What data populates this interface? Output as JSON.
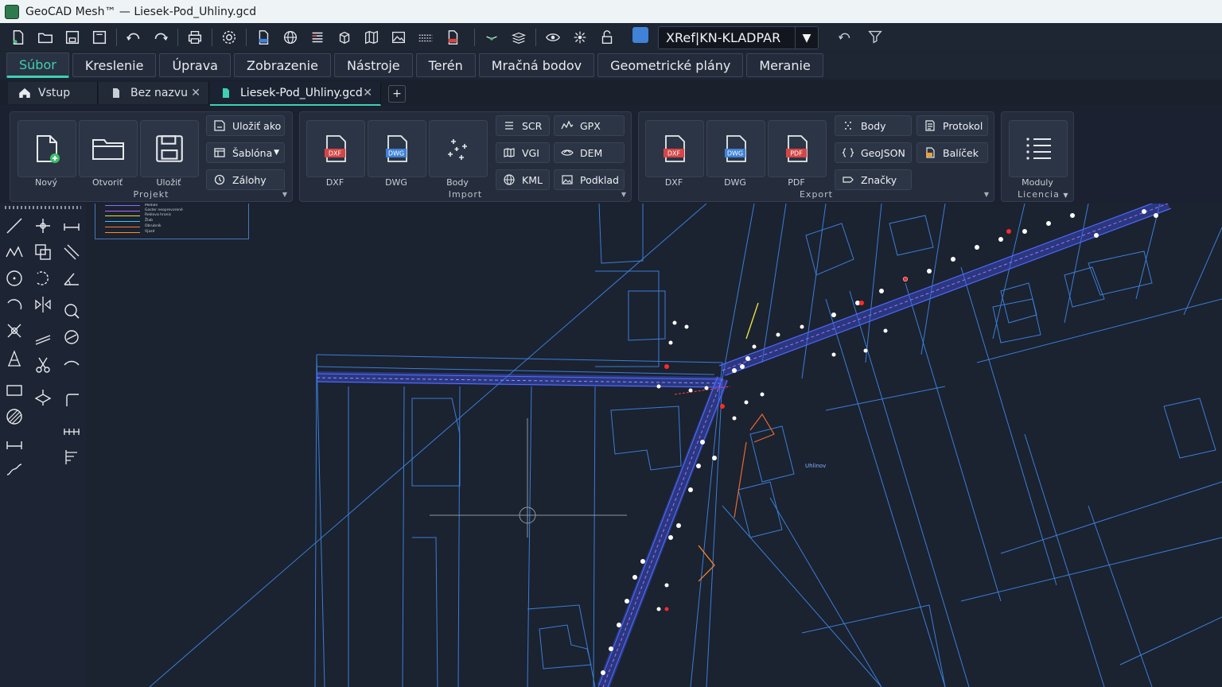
{
  "window": {
    "title": "GeoCAD Mesh™ — Liesek-Pod_Uhliny.gcd"
  },
  "toolbar": {
    "icons": [
      "new-file-icon",
      "open-folder-icon",
      "save-icon",
      "save-as-icon",
      "undo-icon",
      "redo-icon",
      "print-icon",
      "settings-icon",
      "dwg-icon",
      "globe-icon",
      "layers-list-icon",
      "cube-icon",
      "map-icon",
      "image-icon",
      "grid-icon",
      "pdf-icon",
      "route-icon",
      "stack-icon",
      "eye-icon",
      "sun-icon",
      "lock-icon",
      "color-icon",
      "undo-small-icon",
      "filter-icon"
    ],
    "xref_select": "XRef|KN-KLADPAR",
    "layer_color": "#3f82d8"
  },
  "menu": {
    "items": [
      {
        "label": "Súbor"
      },
      {
        "label": "Kreslenie"
      },
      {
        "label": "Úprava"
      },
      {
        "label": "Zobrazenie"
      },
      {
        "label": "Nástroje"
      },
      {
        "label": "Terén"
      },
      {
        "label": "Mračná bodov"
      },
      {
        "label": "Geometrické plány"
      },
      {
        "label": "Meranie"
      }
    ],
    "active": "Súbor"
  },
  "tabs": {
    "items": [
      {
        "label": "Vstup"
      },
      {
        "label": "Bez nazvu"
      },
      {
        "label": "Liesek-Pod_Uhliny.gcd"
      }
    ],
    "add": "+"
  },
  "ribbon": {
    "projekt": {
      "label": "Projekt",
      "big": [
        {
          "label": "Nový"
        },
        {
          "label": "Otvoriť"
        },
        {
          "label": "Uložiť"
        }
      ],
      "small": [
        {
          "label": "Uložiť ako"
        },
        {
          "label": "Šablóna"
        },
        {
          "label": "Zálohy"
        }
      ]
    },
    "import": {
      "label": "Import",
      "big": [
        {
          "label": "DXF",
          "badge": "DXF"
        },
        {
          "label": "DWG",
          "badge": "DWG"
        },
        {
          "label": "Body"
        }
      ],
      "small": [
        {
          "label": "SCR"
        },
        {
          "label": "GPX"
        },
        {
          "label": "VGI"
        },
        {
          "label": "DEM"
        },
        {
          "label": "KML"
        },
        {
          "label": "Podklad"
        }
      ]
    },
    "export": {
      "label": "Export",
      "big": [
        {
          "label": "DXF",
          "badge": "DXF"
        },
        {
          "label": "DWG",
          "badge": "DWG"
        },
        {
          "label": "PDF",
          "badge": "PDF"
        }
      ],
      "small": [
        {
          "label": "Body"
        },
        {
          "label": "Protokol"
        },
        {
          "label": "GeoJSON"
        },
        {
          "label": "Balíček"
        },
        {
          "label": "Značky"
        }
      ]
    },
    "licencia": {
      "label": "Licencia",
      "big": [
        {
          "label": "Moduly"
        }
      ]
    }
  },
  "legend": {
    "items": [
      {
        "label": "Medián",
        "color": "#8a6cff"
      },
      {
        "label": "Gaster neoprevoreně",
        "color": "#b06cff"
      },
      {
        "label": "Reklova hranic",
        "color": "#e6e040"
      },
      {
        "label": "Žlab",
        "color": "#40c0ff"
      },
      {
        "label": "Obrubník",
        "color": "#ff7a30"
      },
      {
        "label": "Vjazd",
        "color": "#ff8a2a"
      }
    ]
  },
  "map": {
    "place_label": "Uhlinov"
  }
}
